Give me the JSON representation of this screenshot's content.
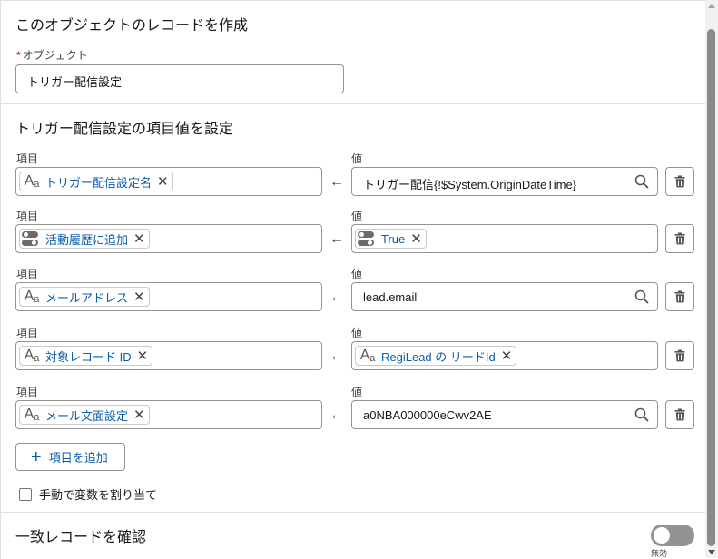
{
  "header": {
    "title": "このオブジェクトのレコードを作成"
  },
  "object_field": {
    "required_mark": "*",
    "label": "オブジェクト",
    "value": "トリガー配信設定"
  },
  "section2": {
    "title": "トリガー配信設定の項目値を設定"
  },
  "field_label": "項目",
  "value_label": "値",
  "rows": [
    {
      "field": {
        "icon": "text-type-icon",
        "label": "トリガー配信設定名"
      },
      "value": {
        "kind": "text",
        "text": "トリガー配信{!$System.OriginDateTime}",
        "search": true
      }
    },
    {
      "field": {
        "icon": "boolean-type-icon",
        "label": "活動履歴に追加"
      },
      "value": {
        "kind": "pill",
        "icon": "boolean-type-icon",
        "label": "True"
      }
    },
    {
      "field": {
        "icon": "text-type-icon",
        "label": "メールアドレス"
      },
      "value": {
        "kind": "text",
        "text": "lead.email",
        "search": true
      }
    },
    {
      "field": {
        "icon": "text-type-icon",
        "label": "対象レコード ID"
      },
      "value": {
        "kind": "pill",
        "icon": "text-type-icon",
        "label": "RegiLead の リードId"
      }
    },
    {
      "field": {
        "icon": "text-type-icon",
        "label": "メール文面設定"
      },
      "value": {
        "kind": "text",
        "text": "a0NBA000000eCwv2AE",
        "search": true
      }
    }
  ],
  "add_button": {
    "label": "項目を追加"
  },
  "manual_assign": {
    "label": "手動で変数を割り当て",
    "checked": false
  },
  "match_section": {
    "title": "一致レコードを確認",
    "toggle_state_label": "無効",
    "enabled": false
  },
  "colors": {
    "link": "#0b5cab",
    "border": "#939393",
    "required": "#ba0517"
  }
}
